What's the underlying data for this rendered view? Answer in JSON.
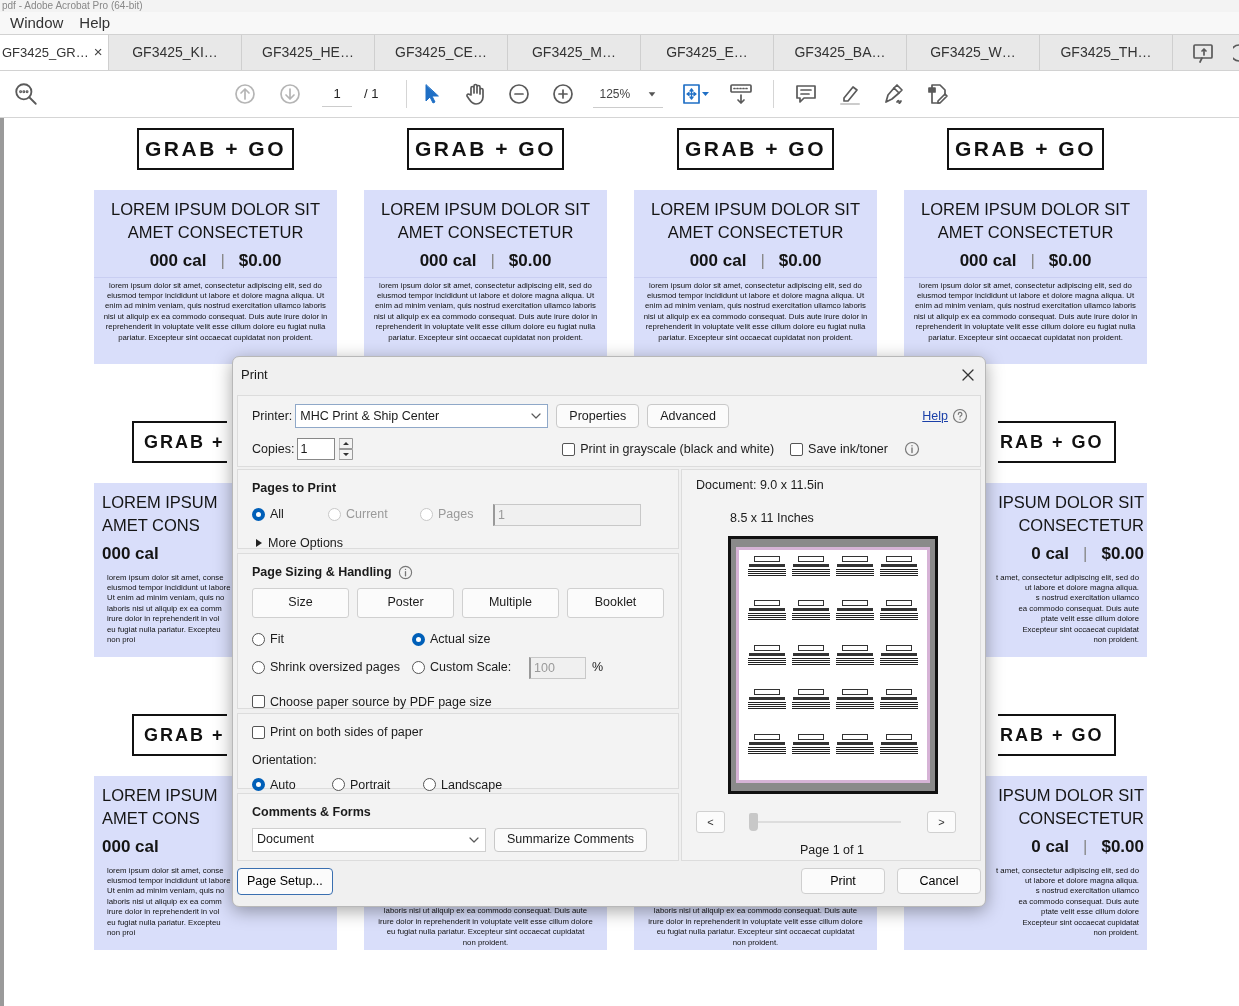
{
  "window": {
    "title": "pdf - Adobe Acrobat Pro (64-bit)"
  },
  "menu": [
    "Window",
    "Help"
  ],
  "tabs": [
    {
      "label": "GF3425_GR…",
      "selected": true,
      "close": "×"
    },
    {
      "label": "GF3425_KI…",
      "selected": false
    },
    {
      "label": "GF3425_HE…",
      "selected": false
    },
    {
      "label": "GF3425_CE…",
      "selected": false
    },
    {
      "label": "GF3425_M…",
      "selected": false
    },
    {
      "label": "GF3425_E…",
      "selected": false
    },
    {
      "label": "GF3425_BA…",
      "selected": false
    },
    {
      "label": "GF3425_W…",
      "selected": false
    },
    {
      "label": "GF3425_TH…",
      "selected": false
    }
  ],
  "toolbar": {
    "page": "1",
    "page_count": "/ 1",
    "zoom": "125%"
  },
  "document": {
    "rows": [
      [
        {
          "kind": "full",
          "logo": "GRAB + GO",
          "title": "LOREM IPSUM DOLOR SIT AMET CONSECTETUR",
          "calories": "000 cal",
          "separator": "|",
          "price": "$0.00",
          "body": "lorem ipsum dolor sit amet, consectetur adipiscing elit, sed do eiusmod tempor incididunt ut labore et dolore magna aliqua. Ut enim ad minim veniam, quis nostrud exercitation ullamco laboris nisi ut aliquip ex ea commodo consequat. Duis aute irure dolor in reprehenderit in voluptate velit esse cillum dolore eu fugiat nulla pariatur. Excepteur sint occaecat cupidatat non proident."
        },
        {
          "kind": "full",
          "logo": "GRAB + GO",
          "title": "LOREM IPSUM DOLOR SIT AMET CONSECTETUR",
          "calories": "000 cal",
          "separator": "|",
          "price": "$0.00",
          "body": "lorem ipsum dolor sit amet, consectetur adipiscing elit, sed do eiusmod tempor incididunt ut labore et dolore magna aliqua. Ut enim ad minim veniam, quis nostrud exercitation ullamco laboris nisi ut aliquip ex ea commodo consequat. Duis aute irure dolor in reprehenderit in voluptate velit esse cillum dolore eu fugiat nulla pariatur. Excepteur sint occaecat cupidatat non proident."
        },
        {
          "kind": "full",
          "logo": "GRAB + GO",
          "title": "LOREM IPSUM DOLOR SIT AMET CONSECTETUR",
          "calories": "000 cal",
          "separator": "|",
          "price": "$0.00",
          "body": "lorem ipsum dolor sit amet, consectetur adipiscing elit, sed do eiusmod tempor incididunt ut labore et dolore magna aliqua. Ut enim ad minim veniam, quis nostrud exercitation ullamco laboris nisi ut aliquip ex ea commodo consequat. Duis aute irure dolor in reprehenderit in voluptate velit esse cillum dolore eu fugiat nulla pariatur. Excepteur sint occaecat cupidatat non proident."
        },
        {
          "kind": "full",
          "logo": "GRAB + GO",
          "title": "LOREM IPSUM DOLOR SIT AMET CONSECTETUR",
          "calories": "000 cal",
          "separator": "|",
          "price": "$0.00",
          "body": "lorem ipsum dolor sit amet, consectetur adipiscing elit, sed do eiusmod tempor incididunt ut labore et dolore magna aliqua. Ut enim ad minim veniam, quis nostrud exercitation ullamco laboris nisi ut aliquip ex ea commodo consequat. Duis aute irure dolor in reprehenderit in voluptate velit esse cillum dolore eu fugiat nulla pariatur. Excepteur sint occaecat cupidatat non proident."
        }
      ],
      [
        {
          "kind": "cut-right",
          "logo": "GRAB +",
          "title": [
            "LOREM IPSUM",
            "AMET CONS"
          ],
          "calories": "000 cal",
          "body": [
            "lorem ipsum dolor sit amet, conse",
            "eiusmod tempor incididunt ut labore",
            "Ut enim ad minim veniam, quis no",
            "laboris nisi ut aliquip ex ea comm",
            "irure dolor in reprehenderit in vol",
            "eu fugiat nulla pariatur. Excepteu",
            "non proi"
          ]
        },
        "",
        "",
        {
          "kind": "cut-left",
          "logo": "RAB + GO",
          "title": [
            "IPSUM DOLOR SIT",
            "CONSECTETUR"
          ],
          "calories": "0 cal",
          "separator": "|",
          "price": "$0.00",
          "body": [
            "t amet, consectetur adipiscing elit, sed do",
            "ut labore et dolore magna aliqua.",
            "s nostrud exercitation ullamco",
            "ea commodo consequat. Duis aute",
            "ptate velit esse cillum dolore",
            "Excepteur sint occaecat cupidatat",
            "non proident."
          ]
        }
      ],
      [
        {
          "kind": "cut-right",
          "logo": "GRAB +",
          "title": [
            "LOREM IPSUM",
            "AMET CONS"
          ],
          "calories": "000 cal",
          "body": [
            "lorem ipsum dolor sit amet, conse",
            "eiusmod tempor incididunt ut labore",
            "Ut enim ad minim veniam, quis no",
            "laboris nisi ut aliquip ex ea comm",
            "irure dolor in reprehenderit in vol",
            "eu fugiat nulla pariatur. Excepteu",
            "non proi"
          ]
        },
        {
          "kind": "bottom",
          "body": [
            "laboris nisi ut aliquip ex ea commodo consequat. Duis aute",
            "irure dolor in reprehenderit in voluptate velit esse cillum dolore",
            "eu fugiat nulla pariatur. Excepteur sint occaecat cupidatat",
            "non proident."
          ]
        },
        {
          "kind": "bottom",
          "body": [
            "laboris nisi ut aliquip ex ea commodo consequat. Duis aute",
            "irure dolor in reprehenderit in voluptate velit esse cillum dolore",
            "eu fugiat nulla pariatur. Excepteur sint occaecat cupidatat",
            "non proident."
          ]
        },
        {
          "kind": "cut-left",
          "logo": "RAB + GO",
          "title": [
            "IPSUM DOLOR SIT",
            "CONSECTETUR"
          ],
          "calories": "0 cal",
          "separator": "|",
          "price": "$0.00",
          "body": [
            "t amet, consectetur adipiscing elit, sed do",
            "ut labore et dolore magna aliqua.",
            "s nostrud exercitation ullamco",
            "ea commodo consequat. Duis aute",
            "ptate velit esse cillum dolore",
            "Excepteur sint occaecat cupidatat",
            "non proident."
          ]
        }
      ]
    ]
  },
  "print_dialog": {
    "title": "Print",
    "printer": {
      "label": "Printer:",
      "value": "MHC Print & Ship Center"
    },
    "printer_buttons": [
      "Properties",
      "Advanced"
    ],
    "help": "Help",
    "copies": {
      "label": "Copies:",
      "value": "1"
    },
    "top_options": [
      {
        "label": "Print in grayscale (black and white)",
        "checked": false
      },
      {
        "label": "Save ink/toner",
        "checked": false
      }
    ],
    "pages_to_print": {
      "title": "Pages to Print",
      "options": [
        {
          "label": "All",
          "selected": true,
          "disabled": false
        },
        {
          "label": "Current",
          "selected": false,
          "disabled": true
        },
        {
          "label": "Pages",
          "selected": false,
          "disabled": true
        }
      ],
      "pages_value": "1",
      "more_options": "More Options"
    },
    "page_sizing": {
      "title": "Page Sizing & Handling",
      "modes": [
        "Size",
        "Poster",
        "Multiple",
        "Booklet"
      ],
      "options": [
        {
          "label": "Fit",
          "selected": false
        },
        {
          "label": "Actual size",
          "selected": true
        },
        {
          "label": "Shrink oversized pages",
          "selected": false
        },
        {
          "label": "Custom Scale:",
          "selected": false
        }
      ],
      "scale_value": "100",
      "scale_unit": "%",
      "paper_source": {
        "label": "Choose paper source by PDF page size",
        "checked": false
      }
    },
    "duplex": {
      "label": "Print on both sides of paper",
      "checked": false
    },
    "orientation": {
      "label": "Orientation:",
      "options": [
        {
          "label": "Auto",
          "selected": true
        },
        {
          "label": "Portrait",
          "selected": false
        },
        {
          "label": "Landscape",
          "selected": false
        }
      ]
    },
    "comments": {
      "title": "Comments & Forms",
      "value": "Document",
      "button": "Summarize Comments"
    },
    "preview": {
      "document_size": "Document: 9.0 x 11.5in",
      "paper_size": "8.5 x 11 Inches",
      "prev": "<",
      "next": ">",
      "level": 0,
      "page_label": "Page 1 of 1"
    },
    "footer": {
      "page_setup": "Page Setup...",
      "print": "Print",
      "cancel": "Cancel"
    }
  }
}
